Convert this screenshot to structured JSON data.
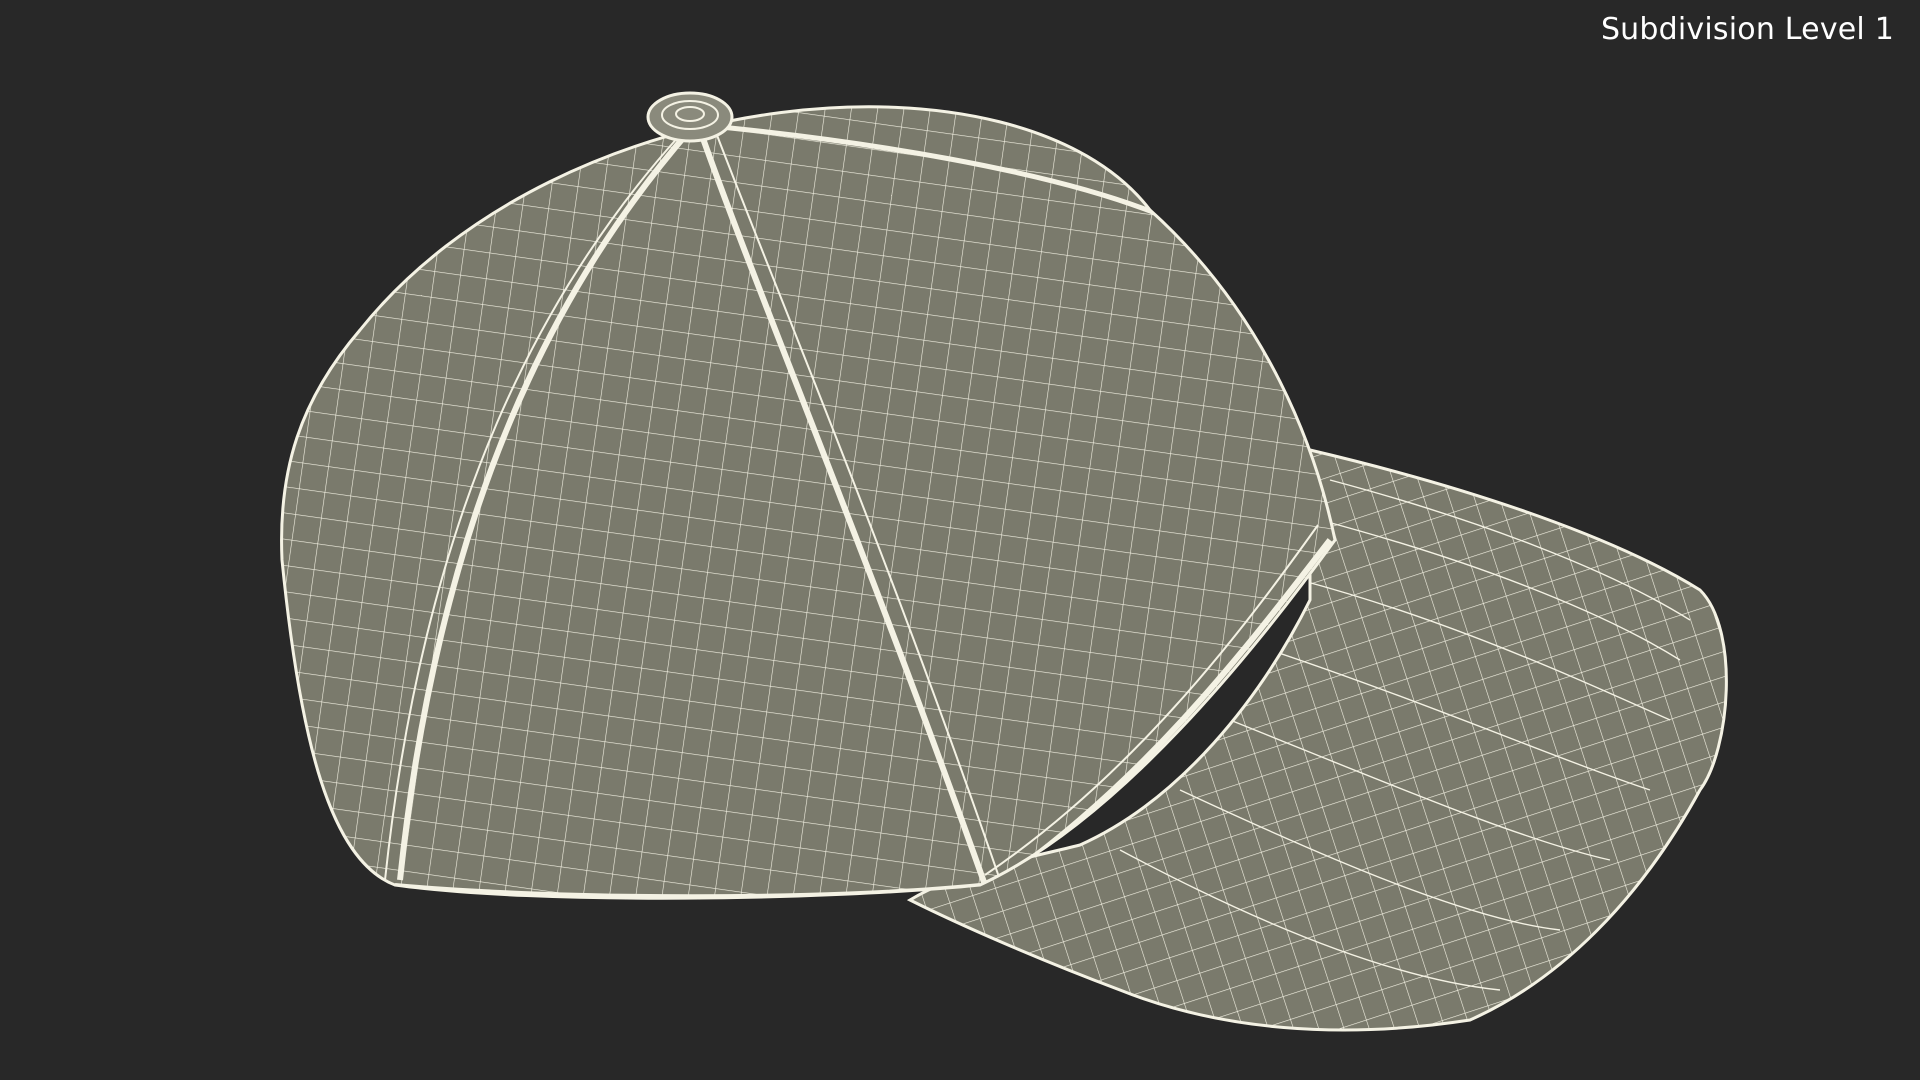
{
  "viewport": {
    "caption": "Subdivision Level 1",
    "background_color": "#282828",
    "mesh_fill_color": "#7a7a6c",
    "mesh_wire_color": "#f4f2e4"
  },
  "object": {
    "name": "baseball-cap-wireframe"
  }
}
